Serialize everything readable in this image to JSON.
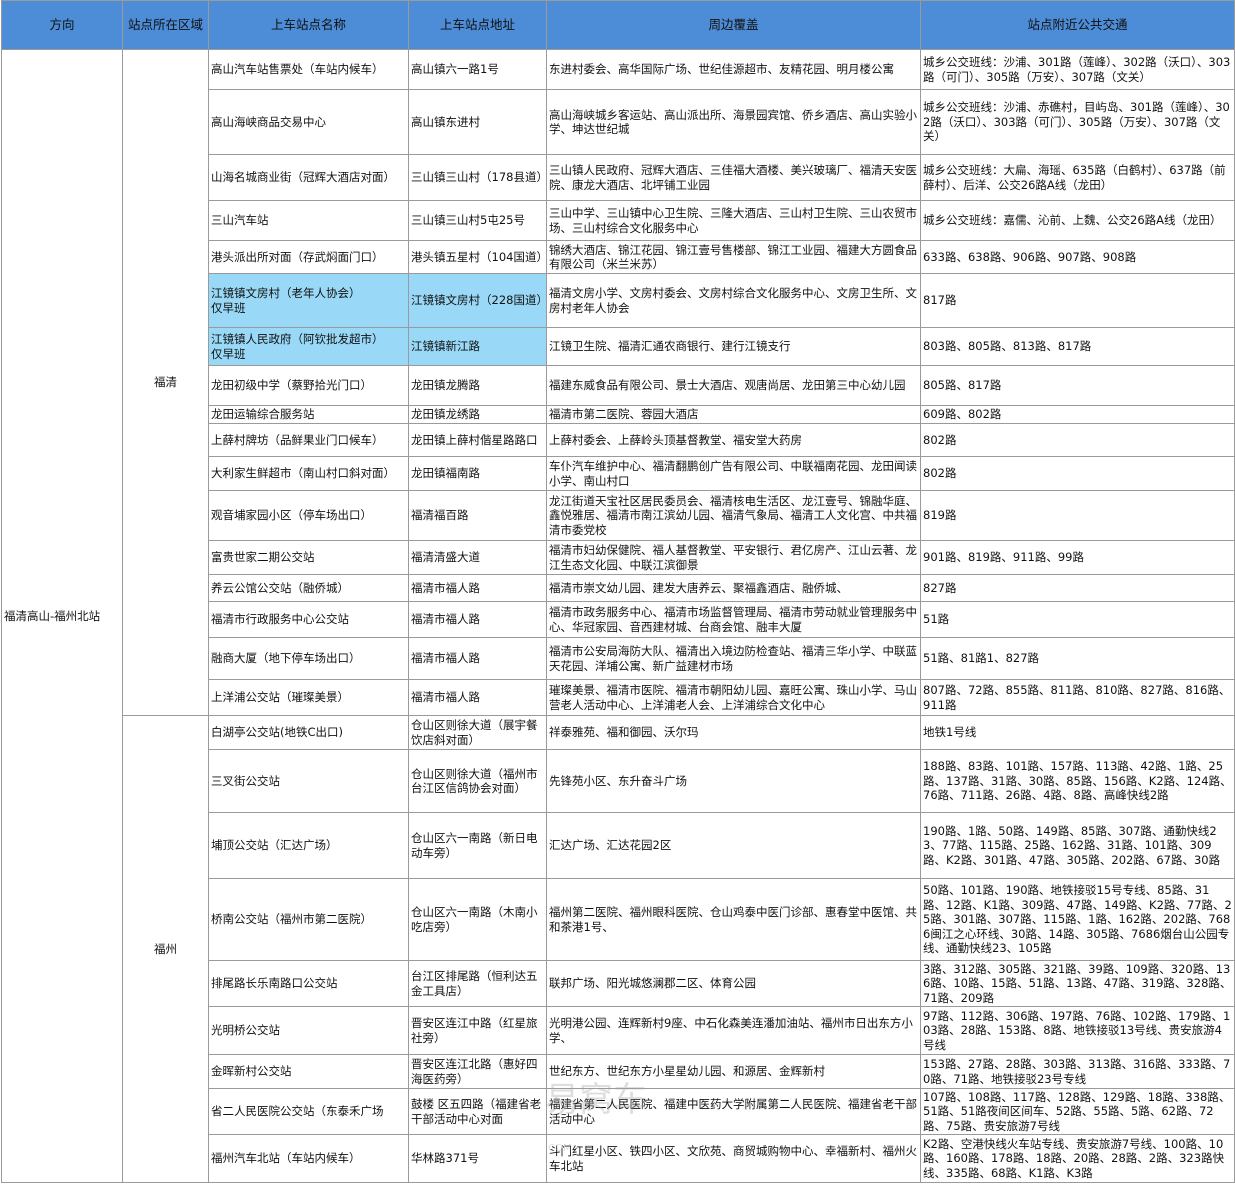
{
  "headers": [
    "方向",
    "站点所在区域",
    "上车站点名称",
    "上车站点地址",
    "周边覆盖",
    "站点附近公共交通"
  ],
  "direction": "福清高山-福州北站",
  "regions": [
    "福清",
    "福州"
  ],
  "rows": [
    {
      "name": "高山汽车站售票处（车站内候车）",
      "addr": "高山镇六一路1号",
      "cover": "东进村委会、高华国际广场、世纪佳源超市、友精花园、明月楼公寓",
      "transit": "城乡公交班线：沙浦、301路（莲峰）、302路（沃口）、303路（可门）、305路（万安）、307路（文关）"
    },
    {
      "name": "高山海峡商品交易中心",
      "addr": "高山镇东进村",
      "cover": "高山海峡城乡客运站、高山派出所、海景园宾馆、侨乡酒店、高山实验小学、坤达世纪城",
      "transit": "城乡公交班线：沙浦、赤礁村，目屿岛、301路（莲峰）、302路（沃口）、303路（可门）、305路（万安）、307路（文关）"
    },
    {
      "name": "山海名城商业街（冠辉大酒店对面）",
      "addr": "三山镇三山村（178县道）",
      "cover": "三山镇人民政府、冠辉大酒店、三佳福大酒楼、美兴玻璃厂、福清天安医院、康龙大酒店、北坪铺工业园",
      "transit": "城乡公交班线：大扁、海瑶、635路（白鹤村）、637路（前薛村）、后洋、公交26路A线（龙田）"
    },
    {
      "name": "三山汽车站",
      "addr": "三山镇三山村5屯25号",
      "cover": "三山中学、三山镇中心卫生院、三隆大酒店、三山村卫生院、三山农贸市场、三山村综合文化服务中心",
      "transit": "城乡公交班线：嘉儒、沁前、上魏、公交26路A线（龙田）"
    },
    {
      "name": "港头派出所对面（存武焖面门口）",
      "addr": "港头镇五星村（104国道）",
      "cover": "锦绣大酒店、锦江花园、锦江壹号售楼部、锦江工业园、福建大方圆食品有限公司（米兰米苏）",
      "transit": "633路、638路、906路、907路、908路"
    },
    {
      "name": "江镜镇文房村（老年人协会）\n仅早班",
      "addr": "江镜镇文房村（228国道）",
      "cover": "福清文房小学、文房村委会、文房村综合文化服务中心、文房卫生所、文房村老年人协会",
      "transit": "817路",
      "hl": true
    },
    {
      "name": "江镜镇人民政府（阿钦批发超市）\n仅早班",
      "addr": "江镜镇新江路",
      "cover": "江镜卫生院、福清汇通农商银行、建行江镜支行",
      "transit": "803路、805路、813路、817路",
      "hl": true
    },
    {
      "name": "龙田初级中学（蔡野拾光门口）",
      "addr": "龙田镇龙腾路",
      "cover": "福建东威食品有限公司、景士大酒店、观唐尚居、龙田第三中心幼儿园",
      "transit": "805路、817路"
    },
    {
      "name": "龙田运输综合服务站",
      "addr": "龙田镇龙绣路",
      "cover": "福清市第二医院、蓉园大酒店",
      "transit": "609路、802路"
    },
    {
      "name": "上薛村牌坊（品鲜果业门口候车）",
      "addr": "龙田镇上薛村偕星路路口",
      "cover": "上薛村委会、上薛岭头顶基督教堂、福安堂大药房",
      "transit": "802路"
    },
    {
      "name": "大利家生鲜超市（南山村口斜对面）",
      "addr": "龙田镇福南路",
      "cover": "车仆汽车维护中心、福清翻鹏创广告有限公司、中联福南花园、龙田闻读小学、南山村口",
      "transit": "802路"
    },
    {
      "name": "观音埔家园小区（停车场出口）",
      "addr": "福清福百路",
      "cover": "龙江街道天宝社区居民委员会、福清核电生活区、龙江壹号、锦融华庭、鑫悦雅居、福清市南江滨幼儿园、福清气象局、福清工人文化宫、中共福清市委党校",
      "transit": "819路"
    },
    {
      "name": "富贵世家二期公交站",
      "addr": "福清清盛大道",
      "cover": "福清市妇幼保健院、福人基督教堂、平安银行、君亿房产、江山云著、龙江生态文化园、中联江滨御景",
      "transit": "901路、819路、911路、99路"
    },
    {
      "name": "养云公馆公交站（融侨城）",
      "addr": "福清市福人路",
      "cover": "福清市崇文幼儿园、建发大唐养云、聚福鑫酒店、融侨城、",
      "transit": "827路"
    },
    {
      "name": "福清市行政服务中心公交站",
      "addr": "福清市福人路",
      "cover": "福清市政务服务中心、福清市场监督管理局、福清市劳动就业管理服务中心、华冠家园、音西建材城、台商会馆、融丰大厦",
      "transit": "51路"
    },
    {
      "name": "融商大厦（地下停车场出口）",
      "addr": "福清市福人路",
      "cover": "福清市公安局海防大队、福清出入境边防检查站、福清三华小学、中联蓝天花园、洋埔公寓、新广益建材市场",
      "transit": "51路、81路1、827路"
    },
    {
      "name": "上洋浦公交站（璀璨美景）",
      "addr": "福清市福人路",
      "cover": "璀璨美景、福清市医院、福清市朝阳幼儿园、嘉旺公寓、珠山小学、马山营老人活动中心、上洋浦老人会、上洋浦综合文化中心",
      "transit": "807路、72路、855路、811路、810路、827路、816路、911路"
    },
    {
      "name": "白湖亭公交站(地铁C出口)",
      "addr": "仓山区则徐大道（展宇餐饮店斜对面）",
      "cover": "祥泰雅苑、福和御园、沃尔玛",
      "transit": "地铁1号线"
    },
    {
      "name": "三叉街公交站",
      "addr": "仓山区则徐大道（福州市台江区信鸽协会对面）",
      "cover": "先锋苑小区、东升奋斗广场",
      "transit": "188路、83路、101路、157路、113路、42路、1路、25路、137路、31路、30路、85路、156路、K2路、124路、76路、711路、26路、4路、8路、高峰快线2路"
    },
    {
      "name": "埔顶公交站（汇达广场）",
      "addr": "仓山区六一南路（新日电动车旁）",
      "cover": "汇达广场、汇达花园2区",
      "transit": "190路、1路、50路、149路、85路、307路、通勤快线23、77路、115路、25路、162路、31路、101路、309路、K2路、301路、47路、305路、202路、67路、30路"
    },
    {
      "name": "桥南公交站（福州市第二医院）",
      "addr": "仓山区六一南路（木南小吃店旁）",
      "cover": "福州第二医院、福州眼科医院、仓山鸡泰中医门诊部、惠春堂中医馆、共和茶港1号、",
      "transit": "50路、101路、190路、地铁接驳15号专线、85路、31路、12路、K1路、309路、47路、149路、K2路、77路、25路、301路、307路、115路、1路、162路、202路、7686闽江之心环线、30路、14路、305路、7686烟台山公园专线、通勤快线23、105路"
    },
    {
      "name": "排尾路长乐南路口公交站",
      "addr": "台江区排尾路（恒利达五金工具店）",
      "cover": "联邦广场、阳光城悠澜郡二区、体育公园",
      "transit": "3路、312路、305路、321路、39路、109路、320路、136路、10路、15路、51路、13路、47路、319路、328路、71路、209路"
    },
    {
      "name": "光明桥公交站",
      "addr": "晋安区连江中路（红星旅社旁）",
      "cover": "光明港公园、连辉新村9座、中石化森美连潘加油站、福州市日出东方小学、",
      "transit": "97路、112路、306路、197路、76路、102路、179路、103路、28路、153路、8路、地铁接驳13号线、贵安旅游4号线"
    },
    {
      "name": "金晖新村公交站",
      "addr": "晋安区连江北路（惠好四海医药旁）",
      "cover": "世纪东方、世纪东方小星星幼儿园、和源居、金辉新村",
      "transit": "153路、27路、28路、303路、313路、316路、333路、70路、71路、地铁接驳23号专线"
    },
    {
      "name": "省二人民医院公交站（东泰禾广场",
      "addr": "鼓楼 区五四路（福建省老干部活动中心对面",
      "cover": "福建省第二人民医院、福建中医药大学附属第二人民医院、福建省老干部活动中心",
      "transit": "107路、108路、117路、128路、129路、18路、338路、51路、51路夜间区间车、52路、55路、5路、62路、72路、75路、贵安旅游7号线"
    },
    {
      "name": "福州汽车北站（车站内候车）",
      "addr": "华林路371号",
      "cover": "斗门红星小区、铁四小区、文欣苑、商贸城购物中心、幸福新村、福州火车北站",
      "transit": "K2路、空港快线火车站专线、贵安旅游7号线、100路、10路、160路、178路、18路、20路、28路、2路、323路快线、335路、68路、K1路、K3路"
    }
  ]
}
